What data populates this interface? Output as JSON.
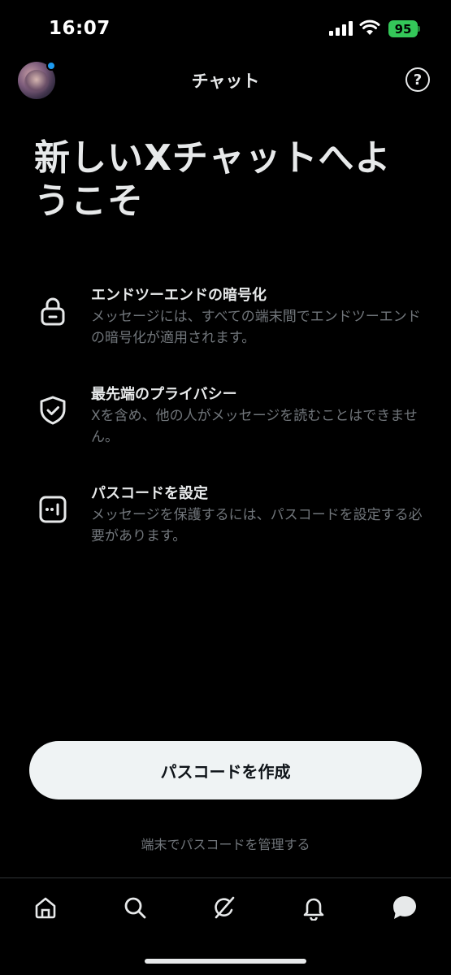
{
  "status_bar": {
    "time": "16:07",
    "battery": "95"
  },
  "header": {
    "title": "チャット",
    "help_glyph": "?"
  },
  "hero": {
    "title": "新しいXチャットへようこそ"
  },
  "features": [
    {
      "icon": "lock-icon",
      "title": "エンドツーエンドの暗号化",
      "description": "メッセージには、すべての端末間でエンドツーエンドの暗号化が適用されます。"
    },
    {
      "icon": "shield-check-icon",
      "title": "最先端のプライバシー",
      "description": "Xを含め、他の人がメッセージを読むことはできません。"
    },
    {
      "icon": "passcode-icon",
      "title": "パスコードを設定",
      "description": "メッセージを保護するには、パスコードを設定する必要があります。"
    }
  ],
  "actions": {
    "primary": "パスコードを作成",
    "secondary": "端末でパスコードを管理する"
  },
  "tabs": [
    {
      "name": "home-icon"
    },
    {
      "name": "search-icon"
    },
    {
      "name": "grok-icon"
    },
    {
      "name": "bell-icon"
    },
    {
      "name": "chat-icon"
    }
  ],
  "colors": {
    "background": "#000000",
    "text": "#e7e9ea",
    "muted": "#71767b",
    "button": "#eff3f4",
    "accent": "#1d9bf0",
    "battery": "#34c759"
  }
}
